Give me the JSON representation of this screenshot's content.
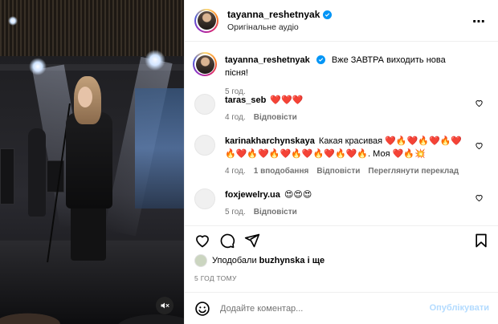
{
  "post": {
    "author": "tayanna_reshetnyak",
    "audio": "Оригінальне аудіо",
    "more_icon": "⋯"
  },
  "caption": {
    "author": "tayanna_reshetnyak",
    "text": "Вже ЗАВТРА виходить нова пісня!",
    "time": "5 год."
  },
  "comments": [
    {
      "user": "taras_seb",
      "text": "❤️❤️❤️",
      "time": "4 год.",
      "likes": "",
      "reply": "Відповісти",
      "translate": ""
    },
    {
      "user": "karinakharchynskaya",
      "text": "Какая красивая ❤️🔥❤️🔥❤️🔥❤️🔥❤️🔥❤️🔥❤️🔥❤️🔥❤️🔥❤️🔥. Моя ❤️🔥💥",
      "time": "4 год.",
      "likes": "1 вподобання",
      "reply": "Відповісти",
      "translate": "Переглянути переклад"
    },
    {
      "user": "foxjewelry.ua",
      "text": "😍😍😍",
      "time": "5 год.",
      "likes": "",
      "reply": "Відповісти",
      "translate": ""
    }
  ],
  "likes_line": {
    "prefix": "Уподобали",
    "user": "buzhynska",
    "suffix": "і ще"
  },
  "timestamp": "5 ГОД ТОМУ",
  "composer": {
    "placeholder": "Додайте коментар...",
    "publish": "Опублікувати"
  },
  "colors": {
    "accent": "#0095f6",
    "publish_disabled": "#b3dbff",
    "heart_red": "#ed4956"
  }
}
